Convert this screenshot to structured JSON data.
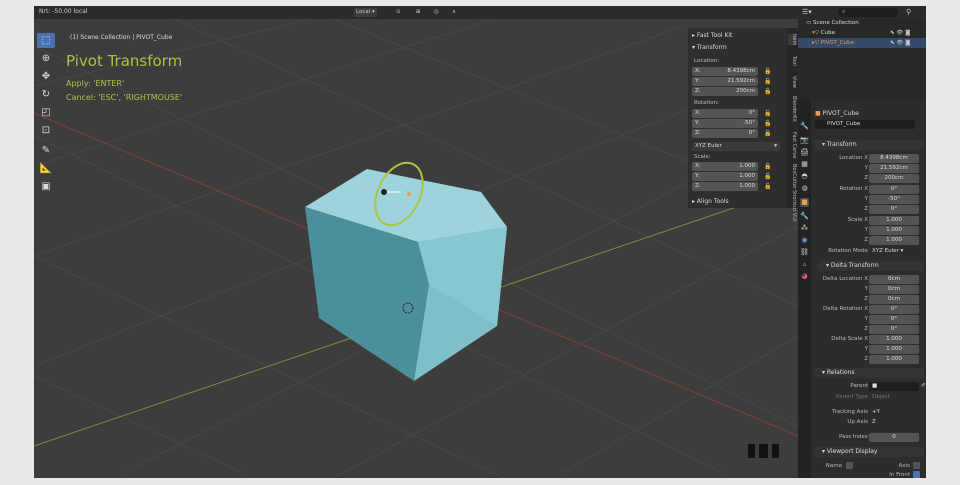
{
  "viewport": {
    "header_left": "Nrt: -50.00 local",
    "orientation": "Local",
    "collection_label": "(1) Scene Collection | PIVOT_Cube",
    "operator": {
      "title": "Pivot Transform",
      "apply": "Apply: 'ENTER'",
      "cancel": "Cancel: 'ESC', 'RIGHTMOUSE'"
    },
    "tools": [
      "select-icon",
      "cursor-icon",
      "move-icon",
      "rotate-icon",
      "scale-icon",
      "transform-icon",
      "annotate-icon",
      "measure-icon",
      "add-cube-icon"
    ]
  },
  "npanel": {
    "fast_tool_kit": "Fast Tool Kit",
    "transform": "Transform",
    "location_label": "Location:",
    "location": [
      {
        "k": "X:",
        "v": "8.4398cm"
      },
      {
        "k": "Y:",
        "v": "21.592cm"
      },
      {
        "k": "Z:",
        "v": "200cm"
      }
    ],
    "rotation_label": "Rotation:",
    "rotation": [
      {
        "k": "X:",
        "v": "0°"
      },
      {
        "k": "Y:",
        "v": "-50°"
      },
      {
        "k": "Z:",
        "v": "0°"
      }
    ],
    "rotation_mode": "XYZ Euler",
    "scale_label": "Scale:",
    "scale": [
      {
        "k": "X:",
        "v": "1.000"
      },
      {
        "k": "Y:",
        "v": "1.000"
      },
      {
        "k": "Z:",
        "v": "1.000"
      }
    ],
    "align_tools": "Align Tools",
    "tabs": [
      "Item",
      "Tool",
      "View",
      "BlenderKit",
      "Fast Carve",
      "BoxCutter",
      "Shortcut VUr"
    ]
  },
  "outliner": {
    "root": "Scene Collection",
    "items": [
      {
        "name": "Cube",
        "color": "#dddddd"
      },
      {
        "name": "PIVOT_Cube",
        "color": "#e8a04a"
      }
    ]
  },
  "properties": {
    "object_name": "PIVOT_Cube",
    "object_field": "PIVOT_Cube",
    "transform": "Transform",
    "location_x_label": "Location X",
    "location": [
      "8.4398cm",
      "21.592cm",
      "200cm"
    ],
    "rotation_x_label": "Rotation X",
    "rotation": [
      "0°",
      "-50°",
      "0°"
    ],
    "scale_x_label": "Scale X",
    "scale": [
      "1.000",
      "1.000",
      "1.000"
    ],
    "rotation_mode_label": "Rotation Mode",
    "rotation_mode": "XYZ Euler",
    "delta_transform": "Delta Transform",
    "delta_location_label": "Delta Location X",
    "delta_location": [
      "0cm",
      "0cm",
      "0cm"
    ],
    "delta_rotation_label": "Delta Rotation X",
    "delta_rotation": [
      "0°",
      "0°",
      "0°"
    ],
    "delta_scale_label": "Delta Scale X",
    "delta_scale": [
      "1.000",
      "1.000",
      "1.000"
    ],
    "y_label": "Y",
    "z_label": "Z",
    "relations": "Relations",
    "parent_label": "Parent",
    "parent_type_label": "Parent Type",
    "parent_type": "Object",
    "tracking_axis_label": "Tracking Axis",
    "tracking_axis": "+Y",
    "up_axis_label": "Up Axis",
    "up_axis": "Z",
    "pass_index_label": "Pass Index",
    "pass_index": "0",
    "viewport_display": "Viewport Display",
    "name_label": "Name",
    "axis_label": "Axis",
    "in_front_label": "In Front"
  },
  "colors": {
    "accent": "#a8c544",
    "selected": "#4a72b3",
    "cube": "#8fc9d1"
  }
}
